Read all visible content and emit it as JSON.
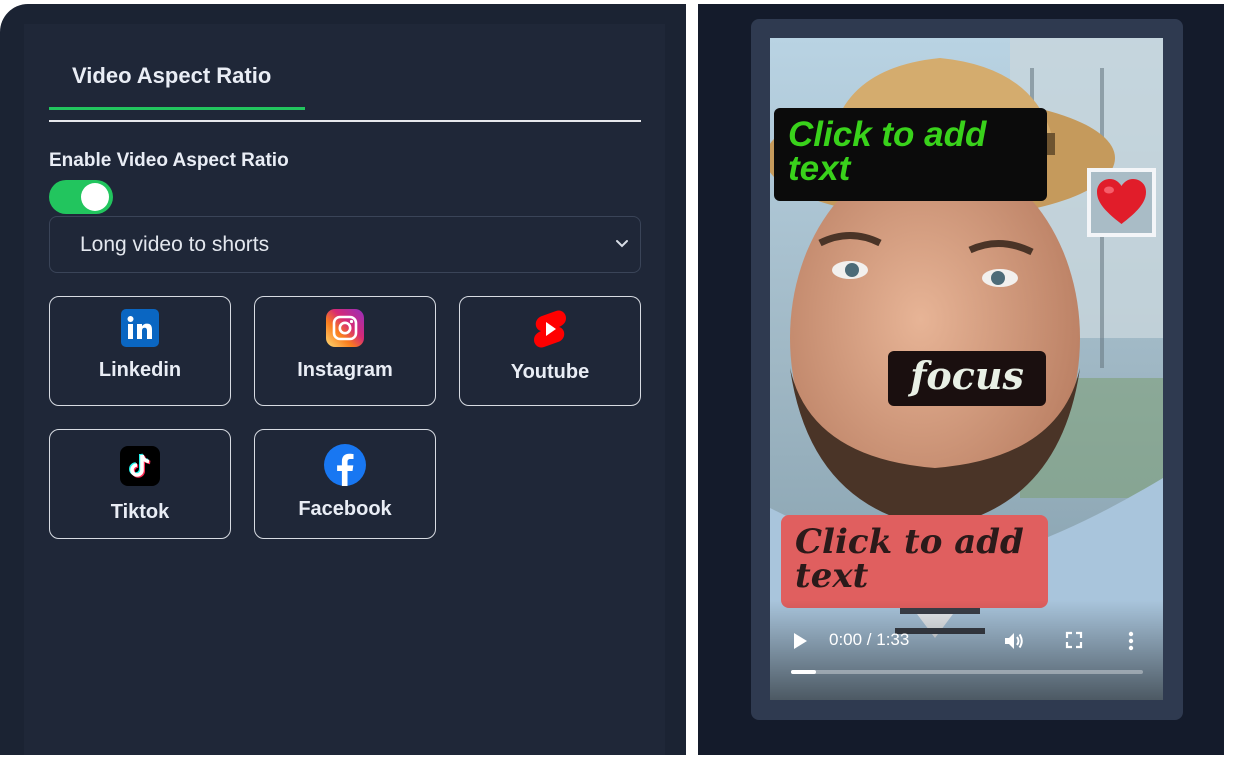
{
  "settings": {
    "tab_label": "Video Aspect Ratio",
    "enable_label": "Enable Video Aspect Ratio",
    "toggle_on": true,
    "select_value": "Long video to shorts",
    "platforms": [
      {
        "label": "Linkedin",
        "icon": "linkedin-icon"
      },
      {
        "label": "Instagram",
        "icon": "instagram-icon"
      },
      {
        "label": "Youtube",
        "icon": "youtube-shorts-icon"
      },
      {
        "label": "Tiktok",
        "icon": "tiktok-icon"
      },
      {
        "label": "Facebook",
        "icon": "facebook-icon"
      }
    ]
  },
  "preview": {
    "overlay_text_top": "Click to add text",
    "overlay_focus": "focus",
    "overlay_text_bottom": "Click to add text",
    "sticker": "❤️",
    "time": "0:00 / 1:33",
    "progress": 0.07
  },
  "colors": {
    "accent": "#22c55e",
    "panel_bg": "#1f2738",
    "overlay_top_text": "#39d21b",
    "overlay_bottom_bg": "#e05f5f"
  }
}
